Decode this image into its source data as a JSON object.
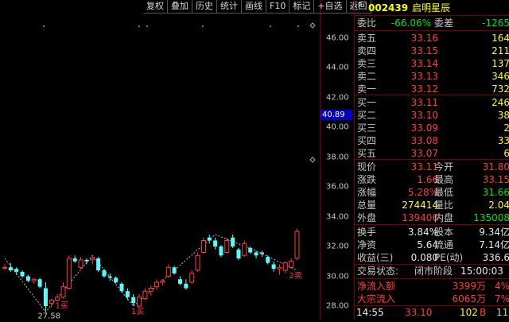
{
  "toolbar": {
    "items": [
      "复权",
      "叠加",
      "历史",
      "统计",
      "画线",
      "F10",
      "标记",
      "+自选",
      "返回"
    ]
  },
  "stock": {
    "marker": "R",
    "code": "002439",
    "name": "启明星辰"
  },
  "weibi": {
    "label": "委比",
    "value": "-66.06%",
    "label2": "委差",
    "value2": "-1265"
  },
  "asks": [
    {
      "label": "卖五",
      "price": "33.16",
      "vol": "164"
    },
    {
      "label": "卖四",
      "price": "33.15",
      "vol": "211"
    },
    {
      "label": "卖三",
      "price": "33.14",
      "vol": "137"
    },
    {
      "label": "卖二",
      "price": "33.13",
      "vol": "346"
    },
    {
      "label": "卖一",
      "price": "33.12",
      "vol": "732"
    }
  ],
  "bids": [
    {
      "label": "买一",
      "price": "33.11",
      "vol": "246"
    },
    {
      "label": "买二",
      "price": "33.10",
      "vol": "38"
    },
    {
      "label": "买三",
      "price": "33.09",
      "vol": "2"
    },
    {
      "label": "买四",
      "price": "33.08",
      "vol": "33"
    },
    {
      "label": "买五",
      "price": "33.07",
      "vol": "6"
    }
  ],
  "stats": [
    {
      "l1": "现价",
      "v1": "33.11",
      "l2": "今开",
      "v2": "31.80"
    },
    {
      "l1": "涨跌",
      "v1": "1.66",
      "l2": "最高",
      "v2": "33.15"
    },
    {
      "l1": "涨幅",
      "v1": "5.28%",
      "l2": "最低",
      "v2": "31.66"
    },
    {
      "l1": "总量",
      "v1": "274414",
      "l2": "量比",
      "v2": "2.04"
    },
    {
      "l1": "外盘",
      "v1": "139406",
      "l2": "内盘",
      "v2": "135008"
    }
  ],
  "fund": [
    {
      "l1": "换手",
      "v1": "3.84%",
      "l2": "股本",
      "v2": "9.34亿"
    },
    {
      "l1": "净资",
      "v1": "5.64",
      "l2": "流通",
      "v2": "7.14亿"
    },
    {
      "l1": "收益(三)",
      "v1": "0.080",
      "l2": "PE(动)",
      "v2": "336.6"
    }
  ],
  "trade_status": {
    "label": "交易状态:",
    "value": "闭市阶段",
    "time": "15:00:03"
  },
  "flows": [
    {
      "label": "净流入额",
      "value": "3399万",
      "pct": "4%"
    },
    {
      "label": "大宗流入",
      "value": "6065万",
      "pct": "7%"
    }
  ],
  "tick": {
    "time": "14:55",
    "price": "33.10",
    "vol": "102",
    "side": "B",
    "count": "11"
  },
  "current_price_tag": "40.89",
  "chart_data": {
    "type": "candlestick",
    "y_ticks": [
      "46.00",
      "44.00",
      "42.00",
      "40.00",
      "38.00",
      "36.00",
      "34.00",
      "32.00",
      "30.00",
      "28.00"
    ],
    "ylim": [
      27.2,
      48.0
    ],
    "candles": [
      [
        30.6,
        30.8,
        30.4,
        30.6
      ],
      [
        30.6,
        30.9,
        30.3,
        30.4
      ],
      [
        30.5,
        30.6,
        30.1,
        30.3
      ],
      [
        30.3,
        30.4,
        29.9,
        30.0
      ],
      [
        30.0,
        30.1,
        29.6,
        29.7
      ],
      [
        29.7,
        29.9,
        29.5,
        29.8
      ],
      [
        29.8,
        29.9,
        29.2,
        29.3
      ],
      [
        29.2,
        29.6,
        27.6,
        28.0
      ],
      [
        28.2,
        28.5,
        27.9,
        28.4
      ],
      [
        28.4,
        28.8,
        28.3,
        28.6
      ],
      [
        28.6,
        29.6,
        28.5,
        29.3
      ],
      [
        29.2,
        31.4,
        29.1,
        31.2
      ],
      [
        31.2,
        31.4,
        30.9,
        31.0
      ],
      [
        30.6,
        31.3,
        30.5,
        31.1
      ],
      [
        31.1,
        31.2,
        30.8,
        31.0
      ],
      [
        31.1,
        31.4,
        30.8,
        31.2
      ],
      [
        31.2,
        31.3,
        30.3,
        30.4
      ],
      [
        30.4,
        30.5,
        29.9,
        30.0
      ],
      [
        30.0,
        30.2,
        29.7,
        29.9
      ],
      [
        29.9,
        30.0,
        29.5,
        29.6
      ],
      [
        29.5,
        29.6,
        28.9,
        29.0
      ],
      [
        29.0,
        29.2,
        28.4,
        28.6
      ],
      [
        28.6,
        28.8,
        28.0,
        28.2
      ],
      [
        28.0,
        28.8,
        27.9,
        28.6
      ],
      [
        28.5,
        29.2,
        28.4,
        29.0
      ],
      [
        29.0,
        29.4,
        28.7,
        29.2
      ],
      [
        29.3,
        29.8,
        29.1,
        29.6
      ],
      [
        29.6,
        29.8,
        29.4,
        29.7
      ],
      [
        30.0,
        30.8,
        29.9,
        30.6
      ],
      [
        30.6,
        30.7,
        30.1,
        30.2
      ],
      [
        29.8,
        30.0,
        29.4,
        29.5
      ],
      [
        29.5,
        29.8,
        29.1,
        29.2
      ],
      [
        29.6,
        30.4,
        29.5,
        30.2
      ],
      [
        30.4,
        31.6,
        30.3,
        31.4
      ],
      [
        31.6,
        32.6,
        31.5,
        32.4
      ],
      [
        32.6,
        32.8,
        32.2,
        32.4
      ],
      [
        32.4,
        32.6,
        31.8,
        32.0
      ],
      [
        32.0,
        32.1,
        31.3,
        31.4
      ],
      [
        31.6,
        32.6,
        31.5,
        32.4
      ],
      [
        32.6,
        32.8,
        31.9,
        32.0
      ],
      [
        31.8,
        31.9,
        31.1,
        31.2
      ],
      [
        31.4,
        32.4,
        31.3,
        32.2
      ],
      [
        31.9,
        32.0,
        31.5,
        31.6
      ],
      [
        31.6,
        31.7,
        31.2,
        31.4
      ],
      [
        31.6,
        31.7,
        31.3,
        31.5
      ],
      [
        31.3,
        31.4,
        30.8,
        30.9
      ],
      [
        30.8,
        31.0,
        30.3,
        30.5
      ],
      [
        30.5,
        30.8,
        30.1,
        30.6
      ],
      [
        30.4,
        31.0,
        30.2,
        30.9
      ],
      [
        30.6,
        31.2,
        30.5,
        31.0
      ],
      [
        31.2,
        33.2,
        31.1,
        33.0
      ]
    ],
    "annotations": [
      {
        "text": "27.58",
        "price": 27.7,
        "idx": 7
      },
      {
        "text": "1买",
        "price": 28.4,
        "idx": 10
      },
      {
        "text": "1买",
        "price": 28.0,
        "idx": 23
      },
      {
        "text": "2卖",
        "price": 30.4,
        "idx": 50
      }
    ]
  }
}
